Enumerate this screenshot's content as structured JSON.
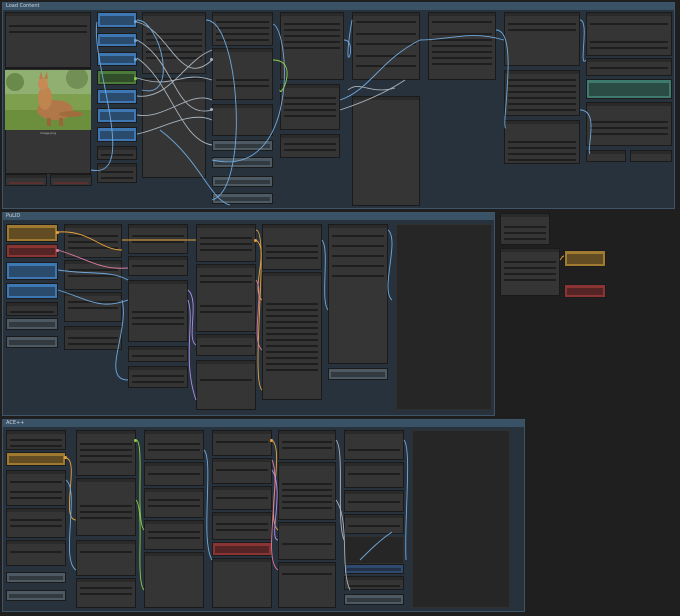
{
  "groups": [
    {
      "id": "load",
      "title": "Load Content"
    },
    {
      "id": "pulid",
      "title": "PuLID"
    },
    {
      "id": "ace",
      "title": "ACE++"
    }
  ],
  "image": {
    "caption": "image.png"
  },
  "colors": {
    "canvas": "#1f1f1f",
    "group_header": "#3a5266",
    "group_body": "#28323c",
    "node": "#353535",
    "node_blue": "#3d78b4",
    "node_green": "#4c7c3c",
    "node_gray": "#4d5963",
    "node_gold": "#a07a30",
    "node_red": "#8a3434",
    "node_teal": "#3f7a6e",
    "wire_blue": "#6fa8dc",
    "wire_orange": "#e8a33c",
    "wire_green": "#8bd14a",
    "wire_purple": "#b08cf0",
    "wire_pink": "#e07aa0",
    "wire_gray": "#a9b3bd"
  }
}
